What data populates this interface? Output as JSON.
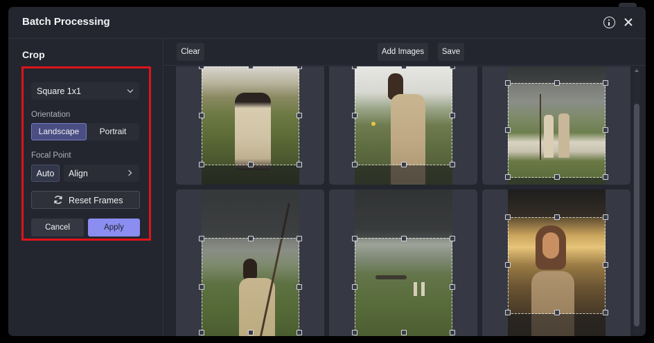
{
  "modal": {
    "title": "Batch Processing",
    "info_icon": "info-circle-icon",
    "close_icon": "close-icon"
  },
  "sidebar": {
    "title": "Crop",
    "aspect_select": {
      "value": "Square 1x1"
    },
    "orientation": {
      "label": "Orientation",
      "options": [
        "Landscape",
        "Portrait"
      ],
      "selected": "Landscape"
    },
    "focal_point": {
      "label": "Focal Point",
      "auto_label": "Auto",
      "align_label": "Align"
    },
    "reset_label": "Reset Frames",
    "cancel_label": "Cancel",
    "apply_label": "Apply"
  },
  "toolbar": {
    "clear_label": "Clear",
    "add_images_label": "Add Images",
    "save_label": "Save"
  },
  "colors": {
    "accent": "#8b8ef0",
    "highlight": "#e1131a",
    "background": "#23262f",
    "card": "#363943"
  },
  "images": [
    {
      "subject": "two women embracing on hillside"
    },
    {
      "subject": "woman holding yellow flower"
    },
    {
      "subject": "couple with sheep flock"
    },
    {
      "subject": "woman with wooden staff"
    },
    {
      "subject": "figures in green valley"
    },
    {
      "subject": "woman at golden hour"
    }
  ]
}
